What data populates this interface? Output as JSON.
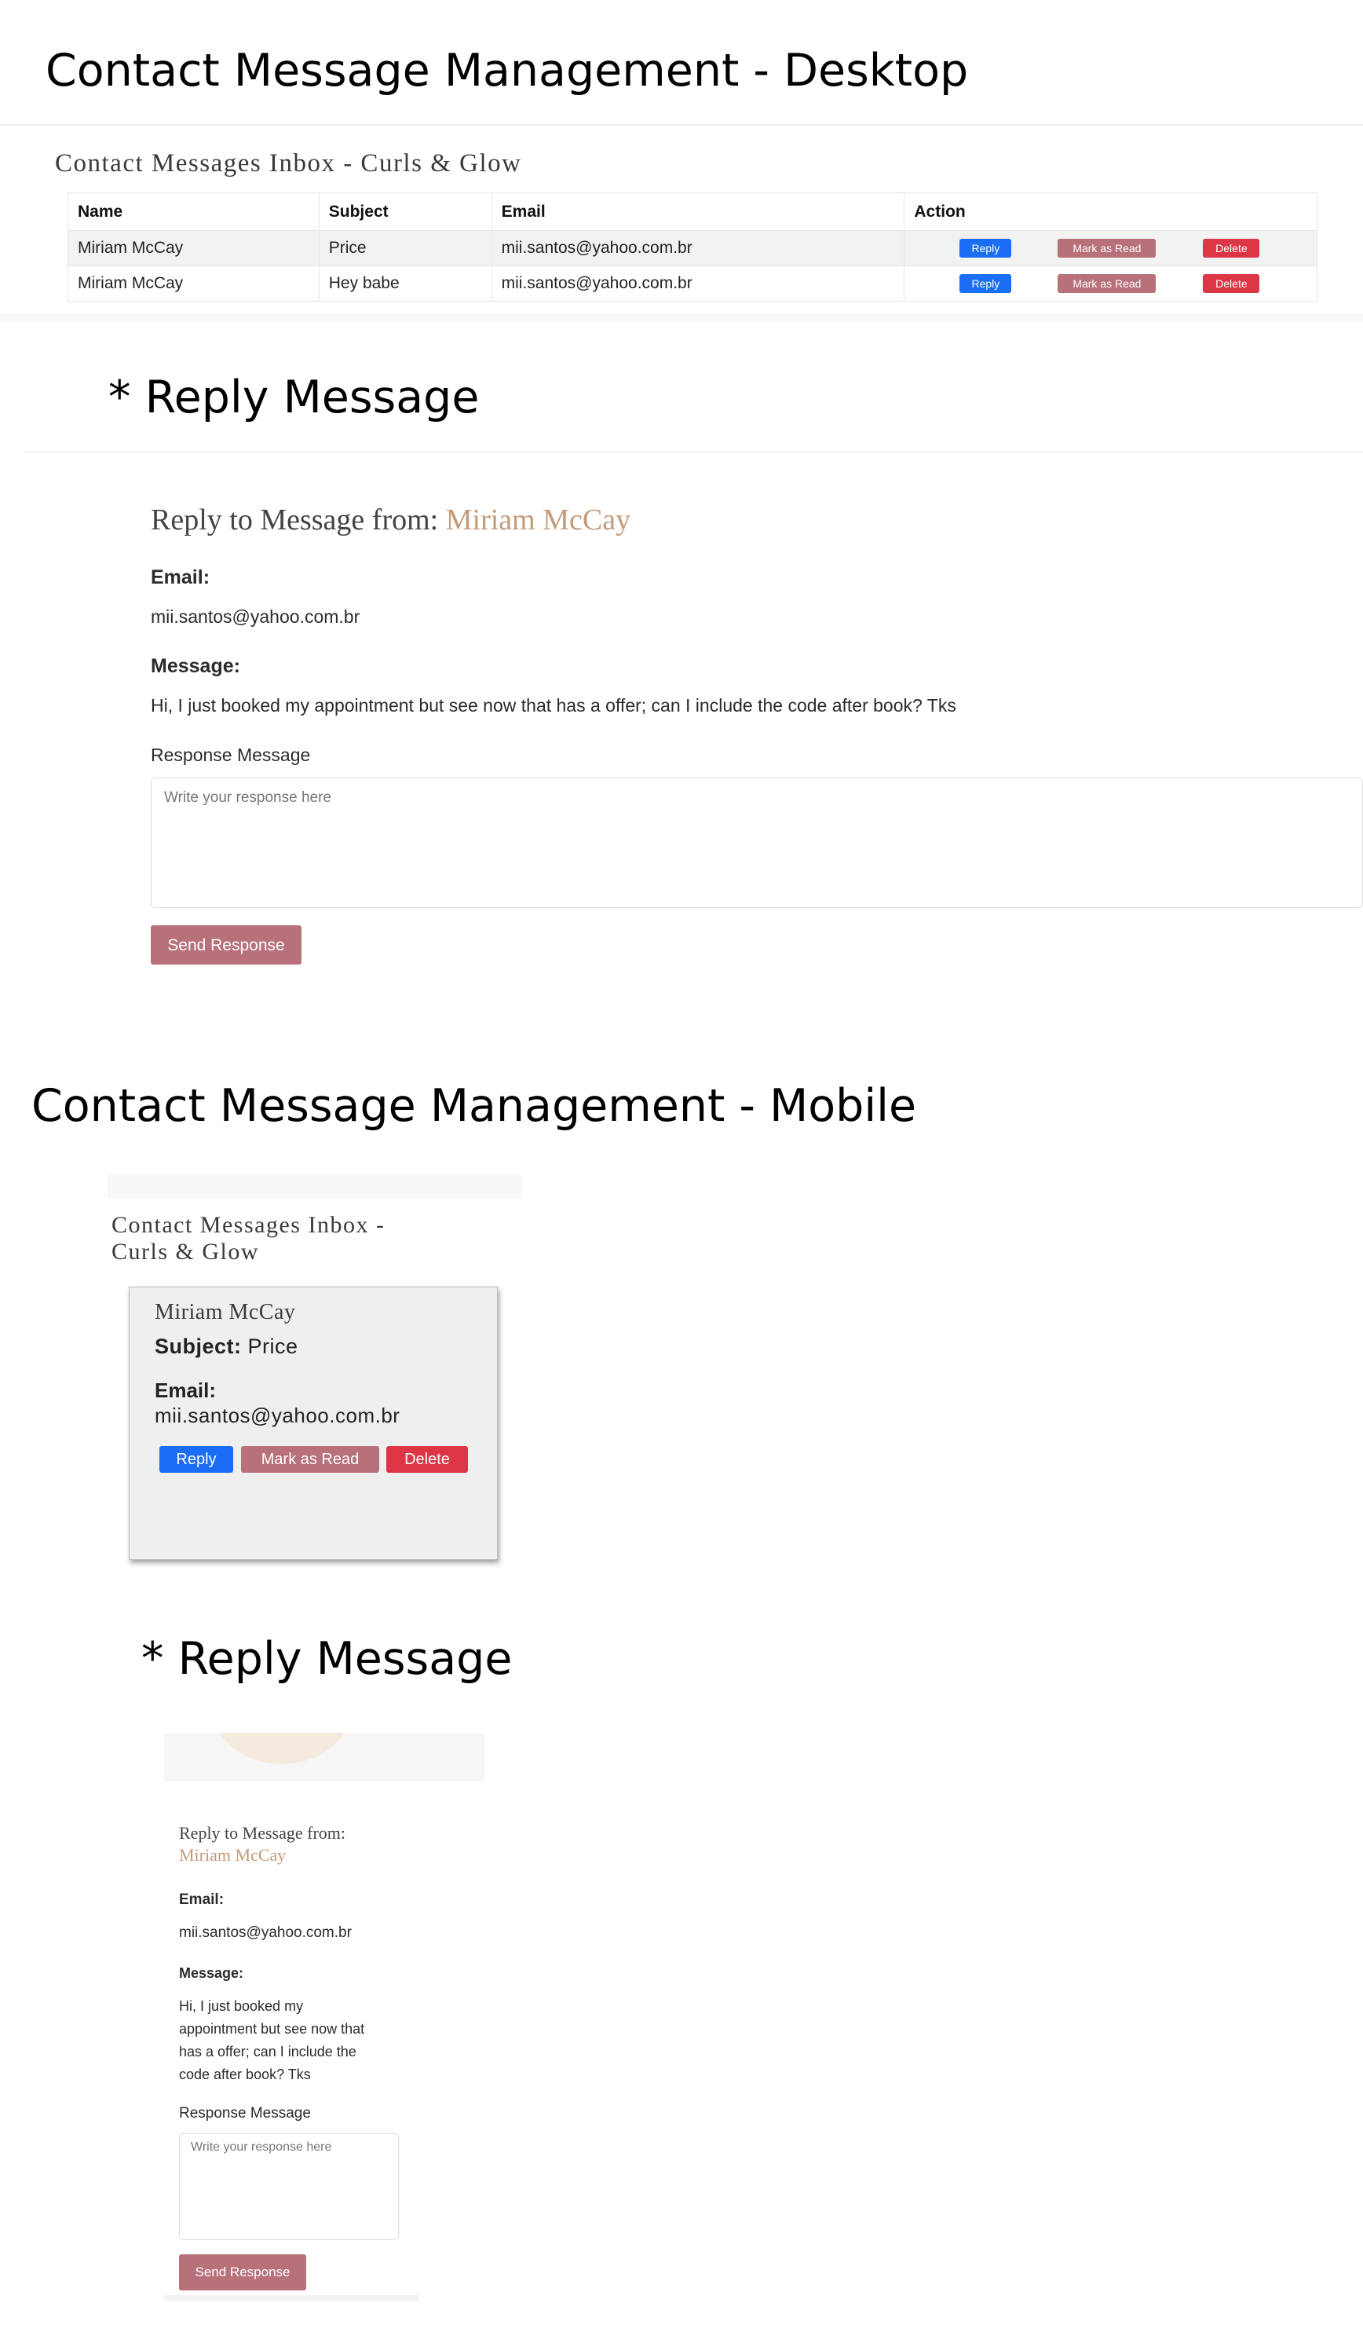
{
  "desktop": {
    "heading": "Contact Message Management - Desktop",
    "inbox_title": "Contact Messages Inbox - Curls & Glow",
    "columns": [
      "Name",
      "Subject",
      "Email",
      "Action"
    ],
    "rows": [
      {
        "name": "Miriam McCay",
        "subject": "Price",
        "email": "mii.santos@yahoo.com.br"
      },
      {
        "name": "Miriam McCay",
        "subject": "Hey babe",
        "email": "mii.santos@yahoo.com.br"
      }
    ],
    "actions": {
      "reply": "Reply",
      "mark_read": "Mark as Read",
      "delete": "Delete"
    },
    "reply_heading": "* Reply Message",
    "reply": {
      "title_prefix": "Reply to Message from:",
      "sender": "Miriam McCay",
      "email_label": "Email:",
      "email": "mii.santos@yahoo.com.br",
      "message_label": "Message:",
      "message": "Hi, I just booked my appointment but see now that has a offer; can I include the code after book? Tks",
      "response_label": "Response Message",
      "response_placeholder": "Write your response here",
      "send_label": "Send Response"
    }
  },
  "mobile": {
    "heading": "Contact Message Management - Mobile",
    "inbox_title_line1": "Contact Messages Inbox -",
    "inbox_title_line2": "Curls & Glow",
    "card": {
      "name": "Miriam McCay",
      "subject_label": "Subject:",
      "subject": "Price",
      "email_label": "Email:",
      "email": "mii.santos@yahoo.com.br"
    },
    "actions": {
      "reply": "Reply",
      "mark_read": "Mark as Read",
      "delete": "Delete"
    },
    "reply_heading": "* Reply Message",
    "reply": {
      "title_prefix": "Reply to Message from:",
      "sender": "Miriam McCay",
      "email_label": "Email:",
      "email": "mii.santos@yahoo.com.br",
      "message_label": "Message:",
      "message_lines": [
        "Hi, I just booked my",
        "appointment but see now that",
        "has a offer; can I include the",
        "code after book? Tks"
      ],
      "response_label": "Response Message",
      "response_placeholder": "Write your response here",
      "send_label": "Send Response"
    }
  },
  "colors": {
    "primary": "#1a6ef5",
    "rose": "#b8707a",
    "danger": "#dc3545",
    "accent_name": "#c39a7a"
  }
}
